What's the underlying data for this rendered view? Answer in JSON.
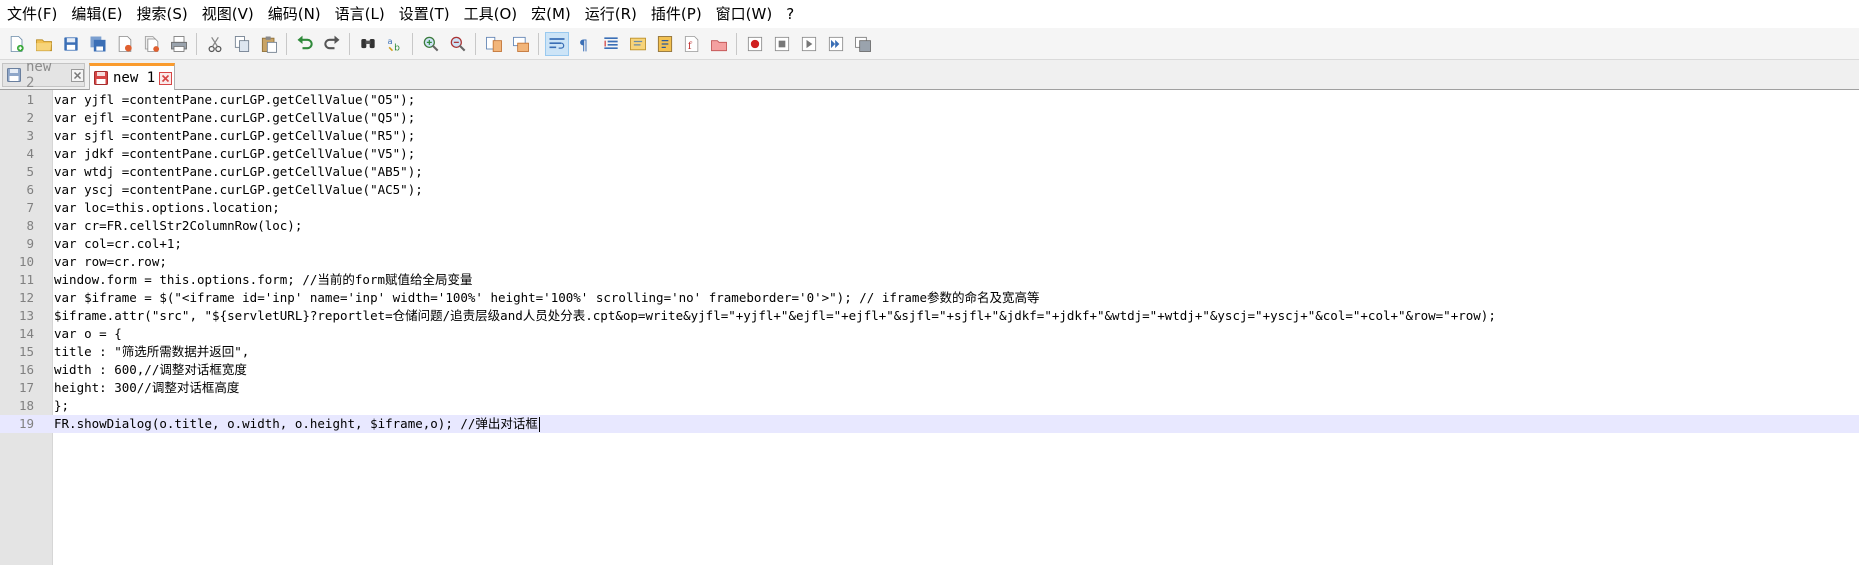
{
  "menu": {
    "items": [
      "文件(F)",
      "编辑(E)",
      "搜索(S)",
      "视图(V)",
      "编码(N)",
      "语言(L)",
      "设置(T)",
      "工具(O)",
      "宏(M)",
      "运行(R)",
      "插件(P)",
      "窗口(W)",
      "?"
    ]
  },
  "toolbar": {
    "buttons": [
      "new-file-icon",
      "open-file-icon",
      "save-icon",
      "save-all-icon",
      "close-icon",
      "close-all-icon",
      "print-icon",
      "cut-icon",
      "copy-icon",
      "paste-icon",
      "undo-icon",
      "redo-icon",
      "find-icon",
      "replace-icon",
      "zoom-in-icon",
      "zoom-out-icon",
      "sync-vertical-icon",
      "sync-horizontal-icon",
      "word-wrap-icon",
      "show-all-characters-icon",
      "indent-guide-icon",
      "document-map-icon",
      "function-list-icon",
      "folder-as-workspace-icon",
      "monitoring-icon",
      "record-macro-icon",
      "stop-recording-icon",
      "playback-macro-icon",
      "run-macro-multiple-icon",
      "save-macro-icon"
    ],
    "active_button": "word-wrap-icon"
  },
  "tabs": [
    {
      "label": "new 2",
      "active": false
    },
    {
      "label": "new 1",
      "active": true
    }
  ],
  "colors": {
    "active_tab_accent": "#fa9b2d",
    "close_icon_red": "#d64545",
    "save_icon_blue": "#3b6fb6",
    "current_line_highlight": "#e8e8ff",
    "whitespace_dot": "#f2b080"
  },
  "editor": {
    "current_line": 19,
    "lines": [
      "var yjfl =contentPane.curLGP.getCellValue(\"O5\");",
      "var ejfl =contentPane.curLGP.getCellValue(\"Q5\");",
      "var sjfl =contentPane.curLGP.getCellValue(\"R5\");",
      "var jdkf =contentPane.curLGP.getCellValue(\"V5\");",
      "var wtdj =contentPane.curLGP.getCellValue(\"AB5\");",
      "var yscj =contentPane.curLGP.getCellValue(\"AC5\");",
      "var loc=this.options.location;",
      "var cr=FR.cellStr2ColumnRow(loc);",
      "var col=cr.col+1;   ",
      "var row=cr.row;",
      "window.form = this.options.form; //当前的form赋值给全局变量",
      "var $iframe = $(\"<iframe id='inp' name='inp' width='100%' height='100%' scrolling='no' frameborder='0'>\"); // iframe参数的命名及宽高等",
      "$iframe.attr(\"src\", \"${servletURL}?reportlet=仓储问题/追责层级and人员处分表.cpt&op=write&yjfl=\"+yjfl+\"&ejfl=\"+ejfl+\"&sjfl=\"+sjfl+\"&jdkf=\"+jdkf+\"&wtdj=\"+wtdj+\"&yscj=\"+yscj+\"&col=\"+col+\"&row=\"+row);",
      "var o = {",
      "title : \"筛选所需数据并返回\",",
      "width : 600,//调整对话框宽度",
      "height: 300//调整对话框高度",
      "};",
      "FR.showDialog(o.title, o.width, o.height, $iframe,o); //弹出对话框"
    ]
  }
}
